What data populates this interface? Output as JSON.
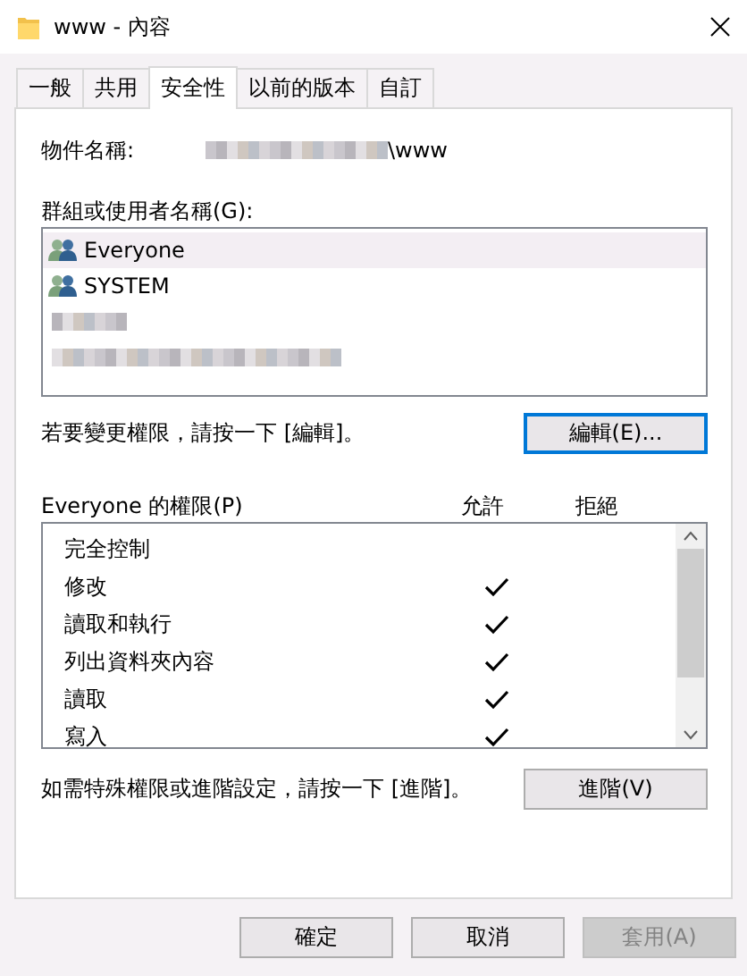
{
  "window": {
    "title": "www - 內容"
  },
  "tabs": [
    {
      "label": "一般",
      "selected": false
    },
    {
      "label": "共用",
      "selected": false
    },
    {
      "label": "安全性",
      "selected": true
    },
    {
      "label": "以前的版本",
      "selected": false
    },
    {
      "label": "自訂",
      "selected": false
    }
  ],
  "object_name": {
    "label": "物件名稱:",
    "value": "\\www",
    "redacted_prefix": true
  },
  "groups": {
    "label": "群組或使用者名稱(G):",
    "items": [
      {
        "kind": "group",
        "name": "Everyone",
        "selected": true
      },
      {
        "kind": "group",
        "name": "SYSTEM",
        "selected": false
      },
      {
        "kind": "redacted",
        "selected": false
      },
      {
        "kind": "redacted",
        "selected": false
      }
    ]
  },
  "edit_hint": "若要變更權限，請按一下 [編輯]。",
  "edit_button": "編輯(E)...",
  "permissions": {
    "label": "Everyone 的權限(P)",
    "allow_header": "允許",
    "deny_header": "拒絕",
    "rows": [
      {
        "name": "完全控制",
        "allow": false,
        "deny": false
      },
      {
        "name": "修改",
        "allow": true,
        "deny": false
      },
      {
        "name": "讀取和執行",
        "allow": true,
        "deny": false
      },
      {
        "name": "列出資料夾內容",
        "allow": true,
        "deny": false
      },
      {
        "name": "讀取",
        "allow": true,
        "deny": false
      },
      {
        "name": "寫入",
        "allow": true,
        "deny": false
      }
    ]
  },
  "advanced_hint": "如需特殊權限或進階設定，請按一下 [進階]。",
  "advanced_button": "進階(V)",
  "buttons": [
    {
      "label": "確定",
      "disabled": false
    },
    {
      "label": "取消",
      "disabled": false
    },
    {
      "label": "套用(A)",
      "disabled": true
    }
  ]
}
